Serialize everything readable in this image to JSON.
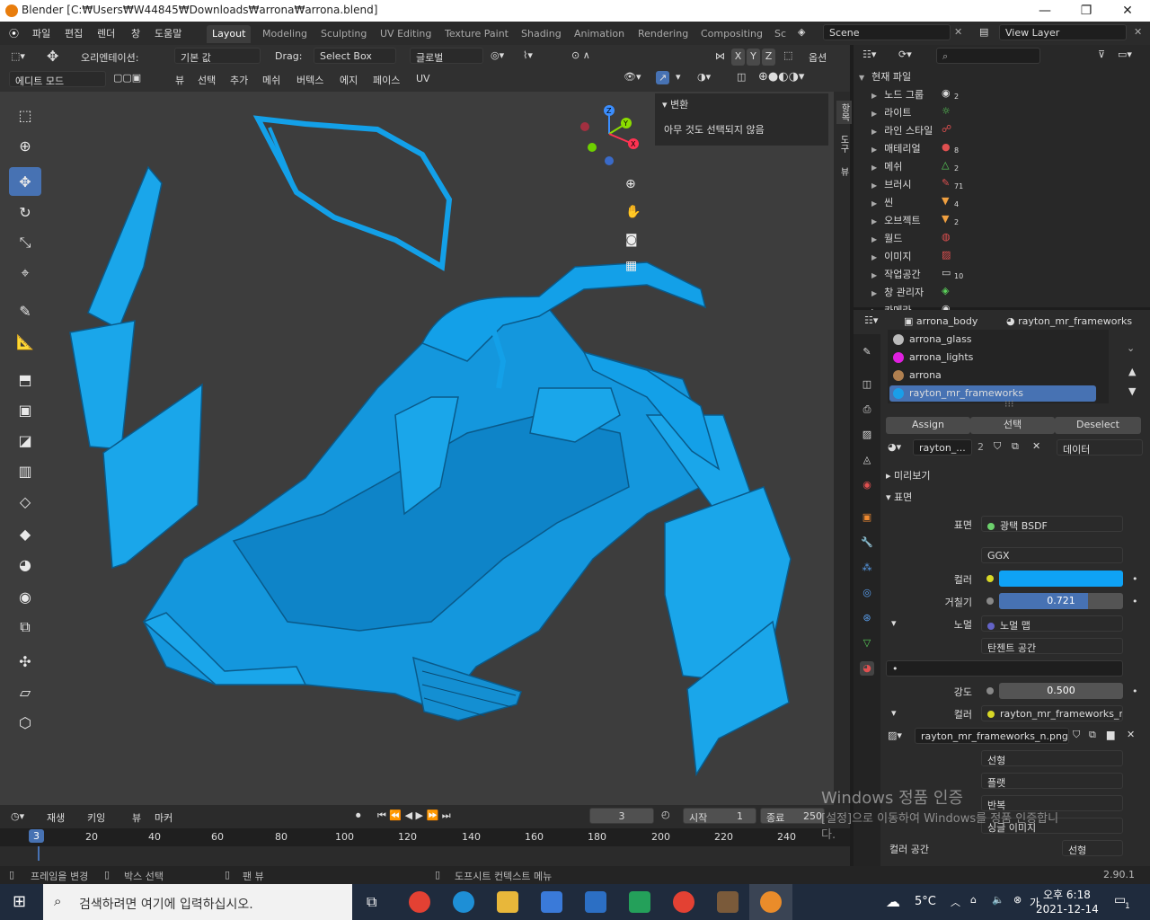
{
  "window": {
    "title": "Blender [C:₩Users₩W44845₩Downloads₩arrona₩arrona.blend]",
    "min": "—",
    "max": "❐",
    "close": "✕"
  },
  "menus": [
    "파일",
    "편집",
    "렌더",
    "창",
    "도움말"
  ],
  "workspaces": [
    "Layout",
    "Modeling",
    "Sculpting",
    "UV Editing",
    "Texture Paint",
    "Shading",
    "Animation",
    "Rendering",
    "Compositing",
    "Sc"
  ],
  "scene": {
    "scene_name": "Scene",
    "view_layer": "View Layer"
  },
  "header1": {
    "orientation_label": "오리엔테이션:",
    "orientation_value": "기본 값",
    "drag_label": "Drag:",
    "drag_value": "Select Box",
    "transform": "글로벌",
    "options": "옵션",
    "axes": [
      "X",
      "Y",
      "Z"
    ]
  },
  "header2": {
    "mode": "에디트 모드",
    "menus": [
      "뷰",
      "선택",
      "추가",
      "메쉬",
      "버텍스",
      "에지",
      "페이스",
      "UV"
    ]
  },
  "npanel": {
    "section": "변환",
    "message": "아무 것도 선택되지 않음"
  },
  "sidetabs": [
    "항목",
    "도구",
    "뷰"
  ],
  "timeline": {
    "menus": [
      "재생",
      "키잉",
      "뷰",
      "마커"
    ],
    "current_frame": "3",
    "start_label": "시작",
    "start": "1",
    "end_label": "종료",
    "end": "250",
    "ruler": [
      "0",
      "20",
      "40",
      "60",
      "80",
      "100",
      "120",
      "140",
      "160",
      "180",
      "200",
      "220",
      "240"
    ],
    "playhead": "3"
  },
  "outliner": {
    "root": "현재 파일",
    "items": [
      {
        "label": "노드 그룹",
        "badge": "2"
      },
      {
        "label": "라이트",
        "badge": ""
      },
      {
        "label": "라인 스타일",
        "badge": ""
      },
      {
        "label": "매테리얼",
        "badge": "8"
      },
      {
        "label": "메쉬",
        "badge": "2"
      },
      {
        "label": "브러시",
        "badge": "71"
      },
      {
        "label": "씬",
        "badge": "4"
      },
      {
        "label": "오브젝트",
        "badge": "2"
      },
      {
        "label": "월드",
        "badge": ""
      },
      {
        "label": "이미지",
        "badge": ""
      },
      {
        "label": "작업공간",
        "badge": "10"
      },
      {
        "label": "창 관리자",
        "badge": ""
      },
      {
        "label": "카메라",
        "badge": ""
      }
    ]
  },
  "props": {
    "object": "arrona_body",
    "material_header": "rayton_mr_frameworks",
    "slots": [
      {
        "name": "arrona_glass",
        "color": "#bbbbbb"
      },
      {
        "name": "arrona_lights",
        "color": "#e020e0"
      },
      {
        "name": "arrona",
        "color": "#b08050"
      },
      {
        "name": "rayton_mr_frameworks",
        "color": "#1a9ee8"
      }
    ],
    "assign": "Assign",
    "select": "선택",
    "deselect": "Deselect",
    "material_name": "rayton_...",
    "users": "2",
    "data_link": "데이터",
    "preview": "미리보기",
    "surface_section": "표면",
    "surface_label": "표면",
    "surface_value": "광택 BSDF",
    "distribution": "GGX",
    "color_label": "컬러",
    "color_value": "#0fa2f5",
    "roughness_label": "거칠기",
    "roughness_value": "0.721",
    "roughness_fill": 0.721,
    "normal_label": "노멀",
    "normal_value": "노멀 맵",
    "tangent_space": "탄젠트 공간",
    "uv_field": "•",
    "strength_label": "강도",
    "strength_value": "0.500",
    "color2_label": "컬러",
    "color2_value": "rayton_mr_frameworks_n....",
    "image_name": "rayton_mr_frameworks_n.png",
    "interp": "선형",
    "projection": "플랫",
    "extension": "반복",
    "source": "싱글 이미지",
    "colorspace_label": "컬러 공간",
    "colorspace_value": "선형"
  },
  "status": {
    "item1": "프레임을 변경",
    "item2": "박스 선택",
    "item3": "팬 뷰",
    "item4": "도프시트 컨텍스트 메뉴",
    "version": "2.90.1"
  },
  "watermark": {
    "line1": "Windows 정품 인증",
    "line2": "[설정]으로 이동하여 Windows를 정품 인증합니",
    "line3": "다."
  },
  "taskbar": {
    "search_placeholder": "검색하려면 여기에 입력하십시오.",
    "weather": "5°C",
    "time": "오후 6:18",
    "date": "2021-12-14",
    "lang": "가",
    "notif": "1"
  },
  "mesh_color": "#14a0e6"
}
